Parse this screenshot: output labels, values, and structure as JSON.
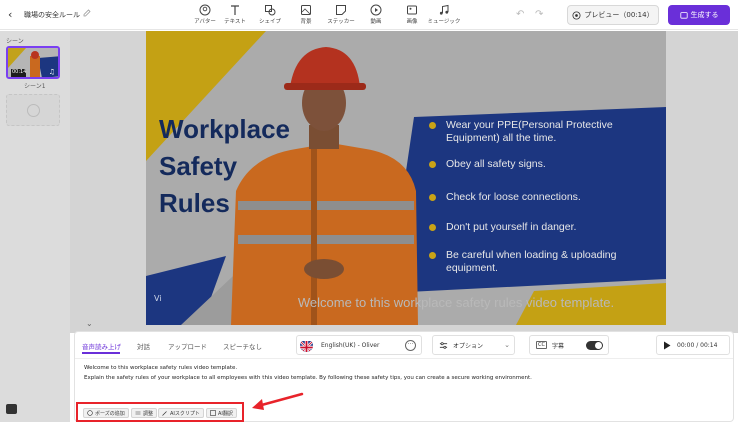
{
  "topbar": {
    "title": "職場の安全ルール",
    "tools": [
      {
        "label": "アバター",
        "icon": "avatar-icon"
      },
      {
        "label": "テキスト",
        "icon": "text-icon"
      },
      {
        "label": "シェイプ",
        "icon": "shape-icon"
      },
      {
        "label": "背景",
        "icon": "background-icon"
      },
      {
        "label": "ステッカー",
        "icon": "sticker-icon"
      },
      {
        "label": "動画",
        "icon": "video-icon"
      },
      {
        "label": "画像",
        "icon": "image-icon"
      },
      {
        "label": "ミュージック",
        "icon": "music-icon"
      }
    ],
    "preview_label": "プレビュー（00:14）",
    "generate_label": "生成する"
  },
  "sidebar": {
    "heading": "シーン",
    "scene_badge": "00:14",
    "scene_name": "シーン1"
  },
  "canvas": {
    "headline": [
      "Workplace",
      "Safety",
      "Rules"
    ],
    "bullets": [
      "Wear your PPE(Personal Protective Equipment) all the time.",
      "Obey all safety signs.",
      "Check for loose connections.",
      "Don't put yourself in danger.",
      "Be careful when loading & uploading equipment."
    ],
    "caption": "Welcome to this workplace safety rules video template.",
    "watermark": "Vi"
  },
  "panel": {
    "tabs": [
      "音声読み上げ",
      "対話",
      "アップロード",
      "スピーチなし"
    ],
    "voice": "English(UK) - Oliver",
    "options_label": "オプション",
    "subtitle_label": "字幕",
    "subtitle_cc": "CC",
    "time": "00:00 / 00:14",
    "script_lines": [
      "Welcome to this workplace safety rules video template.",
      "Explain the safety rules of your workplace to all employees with this video template. By following these safety tips, you can create a secure working environment."
    ],
    "actions": [
      "ポーズの追加",
      "調整",
      "AIスクリプト",
      "AI翻訳"
    ]
  },
  "colors": {
    "accent": "#6a2fd9",
    "navy": "#142a5c",
    "highlight_red": "#e8232a"
  }
}
